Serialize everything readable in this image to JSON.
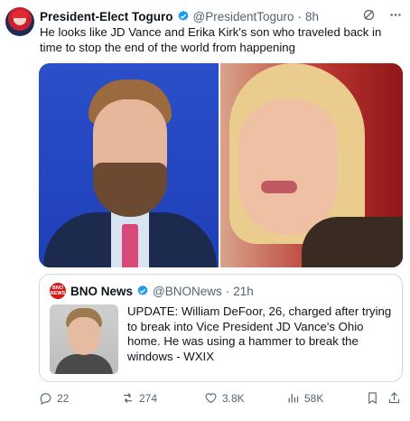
{
  "tweet": {
    "author_name": "President-Elect Toguro",
    "author_handle": "@PresidentToguro",
    "separator": "·",
    "time": "8h",
    "text": "He looks like JD Vance and Erika Kirk's son who traveled back in time to stop the end of the world from happening"
  },
  "quote": {
    "avatar_text": "BNO NEWS",
    "author_name": "BNO News",
    "author_handle": "@BNONews",
    "separator": "·",
    "time": "21h",
    "text": "UPDATE: William DeFoor, 26, charged after trying to break into Vice President JD Vance's Ohio home. He was using a hammer to break the windows - WXIX"
  },
  "actions": {
    "replies": "22",
    "reposts": "274",
    "likes": "3.8K",
    "views": "58K"
  },
  "colors": {
    "verified": "#1d9bf0",
    "muted": "#536471",
    "border": "#cfd9de"
  }
}
